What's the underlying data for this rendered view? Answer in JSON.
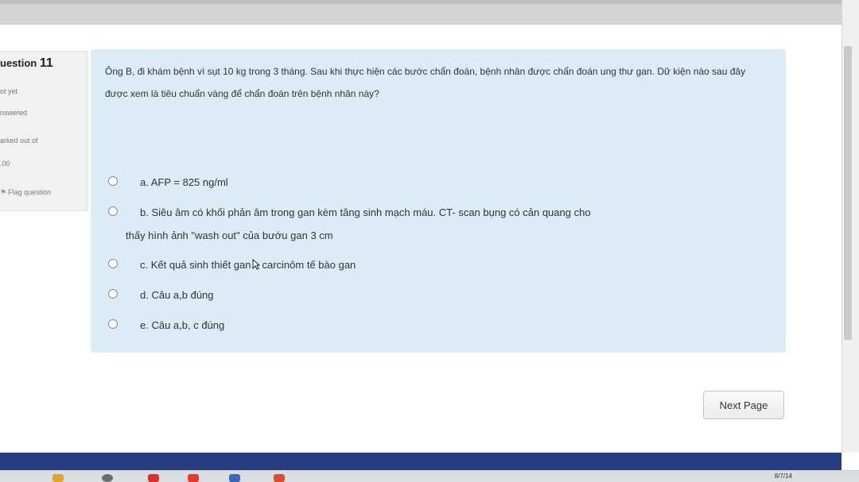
{
  "sidebar": {
    "question_prefix": "uestion",
    "question_number": "11",
    "status_line1": "ot yet",
    "status_line2": "nswered",
    "marks_line1": "arked out of",
    "marks_line2": ".00",
    "flag_label": "Flag question"
  },
  "question": {
    "text": "Ông B, đi khám bệnh vì sụt 10 kg trong 3 tháng. Sau khi thực hiện các bước chẩn đoán, bệnh nhân được chẩn đoán ung thư gan. Dữ kiện nào sau đây được xem là tiêu chuẩn vàng để chẩn đoán trên bệnh nhân này?",
    "answers": [
      {
        "label": "a. AFP = 825 ng/ml"
      },
      {
        "label": "b. Siêu âm có khối phản âm trong gan kèm tăng sinh mạch máu. CT- scan bụng có cản quang cho",
        "line2": "thấy hình ảnh \"wash out\" của bướu gan 3 cm"
      },
      {
        "label_before": "c. Kết quả sinh thiết gan",
        "label_after": "carcinôm tế bào gan"
      },
      {
        "label": "d. Câu a,b đúng"
      },
      {
        "label": "e. Câu a,b, c đúng"
      }
    ]
  },
  "nav": {
    "next_label": "Next Page"
  },
  "taskbar": {
    "clock": "8/7/14"
  },
  "colors": {
    "question_bg": "#dcecf7",
    "footer_bar": "#263e84",
    "info_panel": "#f1f1f1"
  }
}
